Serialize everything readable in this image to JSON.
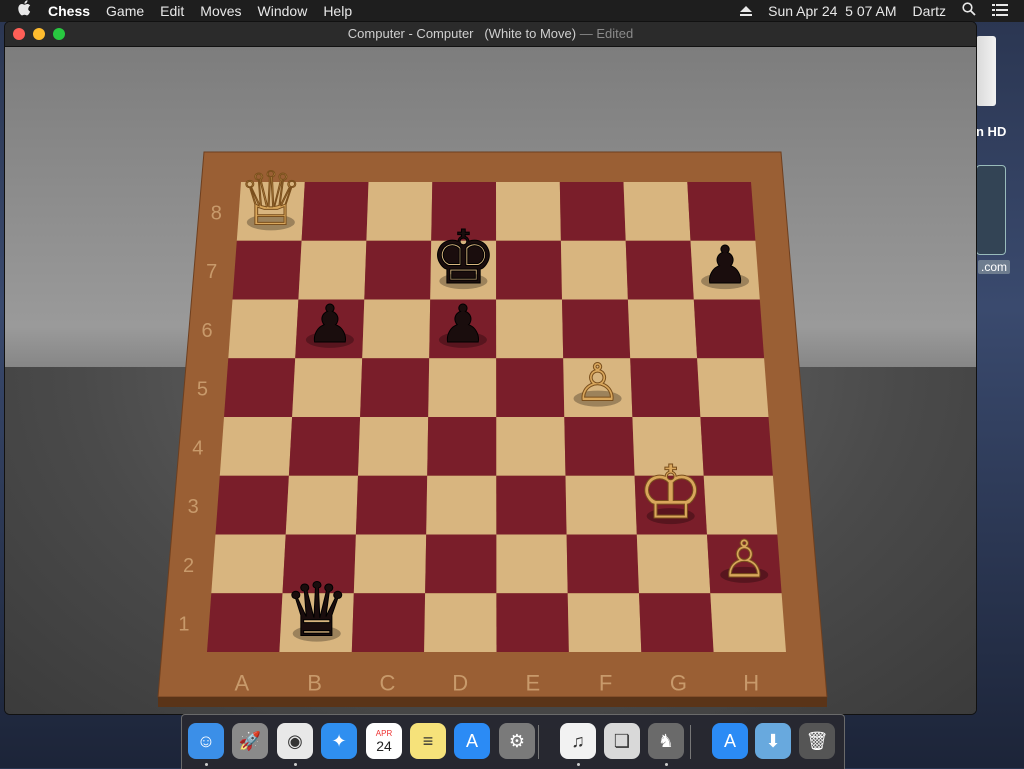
{
  "menubar": {
    "apple_icon": "apple-icon",
    "app_name": "Chess",
    "menus": [
      "Game",
      "Edit",
      "Moves",
      "Window",
      "Help"
    ],
    "datetime": "Sun Apr 24  5 07 AM",
    "user": "Dartz",
    "icons": [
      "eject-icon",
      "search-icon",
      "list-icon"
    ]
  },
  "desktop": {
    "drive_label": "n HD",
    "web_label": ".com"
  },
  "window": {
    "title": "Computer - Computer   (White to Move)",
    "edited": "— Edited",
    "traffic_lights": {
      "close": "#ff5f57",
      "minimize": "#febc2e",
      "zoom": "#28c840"
    }
  },
  "board": {
    "files": [
      "A",
      "B",
      "C",
      "D",
      "E",
      "F",
      "G",
      "H"
    ],
    "ranks": [
      "8",
      "7",
      "6",
      "5",
      "4",
      "3",
      "2",
      "1"
    ],
    "light_square": "#d8b57f",
    "dark_square": "#7a1e2a",
    "frame_color": "#9a5f34",
    "pieces": [
      {
        "color": "white",
        "type": "queen",
        "square": "a8",
        "icon": "white-queen-icon",
        "glyph": "♕"
      },
      {
        "color": "black",
        "type": "king",
        "square": "d7",
        "icon": "black-king-icon",
        "glyph": "♚"
      },
      {
        "color": "black",
        "type": "pawn",
        "square": "h7",
        "icon": "black-pawn-icon",
        "glyph": "♟"
      },
      {
        "color": "black",
        "type": "pawn",
        "square": "b6",
        "icon": "black-pawn-icon",
        "glyph": "♟"
      },
      {
        "color": "black",
        "type": "pawn",
        "square": "d6",
        "icon": "black-pawn-icon",
        "glyph": "♟"
      },
      {
        "color": "white",
        "type": "pawn",
        "square": "f5",
        "icon": "white-pawn-icon",
        "glyph": "♙"
      },
      {
        "color": "white",
        "type": "king",
        "square": "g3",
        "icon": "white-king-icon",
        "glyph": "♔"
      },
      {
        "color": "white",
        "type": "pawn",
        "square": "h2",
        "icon": "white-pawn-icon",
        "glyph": "♙"
      },
      {
        "color": "black",
        "type": "queen",
        "square": "b1",
        "icon": "black-queen-icon",
        "glyph": "♛"
      }
    ]
  },
  "dock": {
    "apps": [
      {
        "name": "Finder",
        "icon": "finder-icon",
        "glyph": "☺",
        "bg": "#3b8fe8",
        "running": true
      },
      {
        "name": "Launchpad",
        "icon": "rocket-icon",
        "glyph": "🚀",
        "bg": "#8a8a8a",
        "running": false
      },
      {
        "name": "Chrome",
        "icon": "chrome-icon",
        "glyph": "◉",
        "bg": "#e8e8e8",
        "running": true
      },
      {
        "name": "Safari",
        "icon": "safari-icon",
        "glyph": "✦",
        "bg": "#2f8ff0",
        "running": false
      },
      {
        "name": "Calendar",
        "icon": "calendar-icon",
        "glyph": "24",
        "bg": "#ffffff",
        "running": false
      },
      {
        "name": "Notes",
        "icon": "notes-icon",
        "glyph": "≡",
        "bg": "#f6e27a",
        "running": false
      },
      {
        "name": "App Store",
        "icon": "appstore-icon",
        "glyph": "A",
        "bg": "#2b8bf5",
        "running": false
      },
      {
        "name": "System Preferences",
        "icon": "gear-icon",
        "glyph": "⚙",
        "bg": "#7a7a7a",
        "running": false
      },
      {
        "name": "iTunes",
        "icon": "music-icon",
        "glyph": "♫",
        "bg": "#f2f2f2",
        "running": true
      },
      {
        "name": "Preview",
        "icon": "preview-icon",
        "glyph": "❏",
        "bg": "#d9d9d9",
        "running": false
      },
      {
        "name": "Chess",
        "icon": "chess-icon",
        "glyph": "♞",
        "bg": "#6a6a6a",
        "running": true
      },
      {
        "name": "App Store Downloads",
        "icon": "download-icon",
        "glyph": "A",
        "bg": "#2b8bf5",
        "running": false
      },
      {
        "name": "Downloads",
        "icon": "folder-icon",
        "glyph": "⬇",
        "bg": "#68a9de",
        "running": false
      },
      {
        "name": "Trash",
        "icon": "trash-icon",
        "glyph": "🗑",
        "bg": "#555",
        "running": false
      }
    ],
    "calendar_month": "APR",
    "calendar_day": "24"
  }
}
